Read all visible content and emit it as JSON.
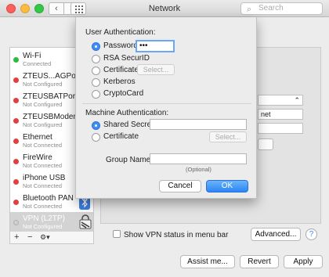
{
  "window": {
    "title": "Network"
  },
  "search": {
    "placeholder": "Search"
  },
  "sidebar": {
    "services": [
      {
        "name": "Wi-Fi",
        "status": "Connected",
        "color": "#2bbb3e"
      },
      {
        "name": "ZTEUS...AGPort",
        "status": "Not Configured",
        "color": "#e04040"
      },
      {
        "name": "ZTEUSBATPort",
        "status": "Not Configured",
        "color": "#e04040"
      },
      {
        "name": "ZTEUSBModem",
        "status": "Not Configured",
        "color": "#e04040"
      },
      {
        "name": "Ethernet",
        "status": "Not Connected",
        "color": "#e04040"
      },
      {
        "name": "FireWire",
        "status": "Not Connected",
        "color": "#e04040"
      },
      {
        "name": "iPhone USB",
        "status": "Not Connected",
        "color": "#e04040"
      },
      {
        "name": "Bluetooth PAN",
        "status": "Not Connected",
        "color": "#e04040"
      },
      {
        "name": "VPN (L2TP)",
        "status": "Not Configured",
        "color": "#cfcfcf"
      }
    ],
    "footer": {
      "add": "+",
      "remove": "−",
      "gear": "⚙▾"
    }
  },
  "background": {
    "field_fragment": "net",
    "show_vpn_label": "Show VPN status in menu bar",
    "advanced_label": "Advanced...",
    "help_label": "?",
    "assist_label": "Assist me...",
    "revert_label": "Revert",
    "apply_label": "Apply"
  },
  "sheet": {
    "user_auth_title": "User Authentication:",
    "user_options": [
      "Password:",
      "RSA SecurID",
      "Certificate",
      "Kerberos",
      "CryptoCard"
    ],
    "password_value": "•••",
    "select_label": "Select...",
    "machine_auth_title": "Machine Authentication:",
    "machine_options": [
      "Shared Secret:",
      "Certificate"
    ],
    "group_name_label": "Group Name:",
    "optional_hint": "(Optional)",
    "cancel_label": "Cancel",
    "ok_label": "OK"
  },
  "colors": {
    "accent": "#3d8ff7"
  }
}
